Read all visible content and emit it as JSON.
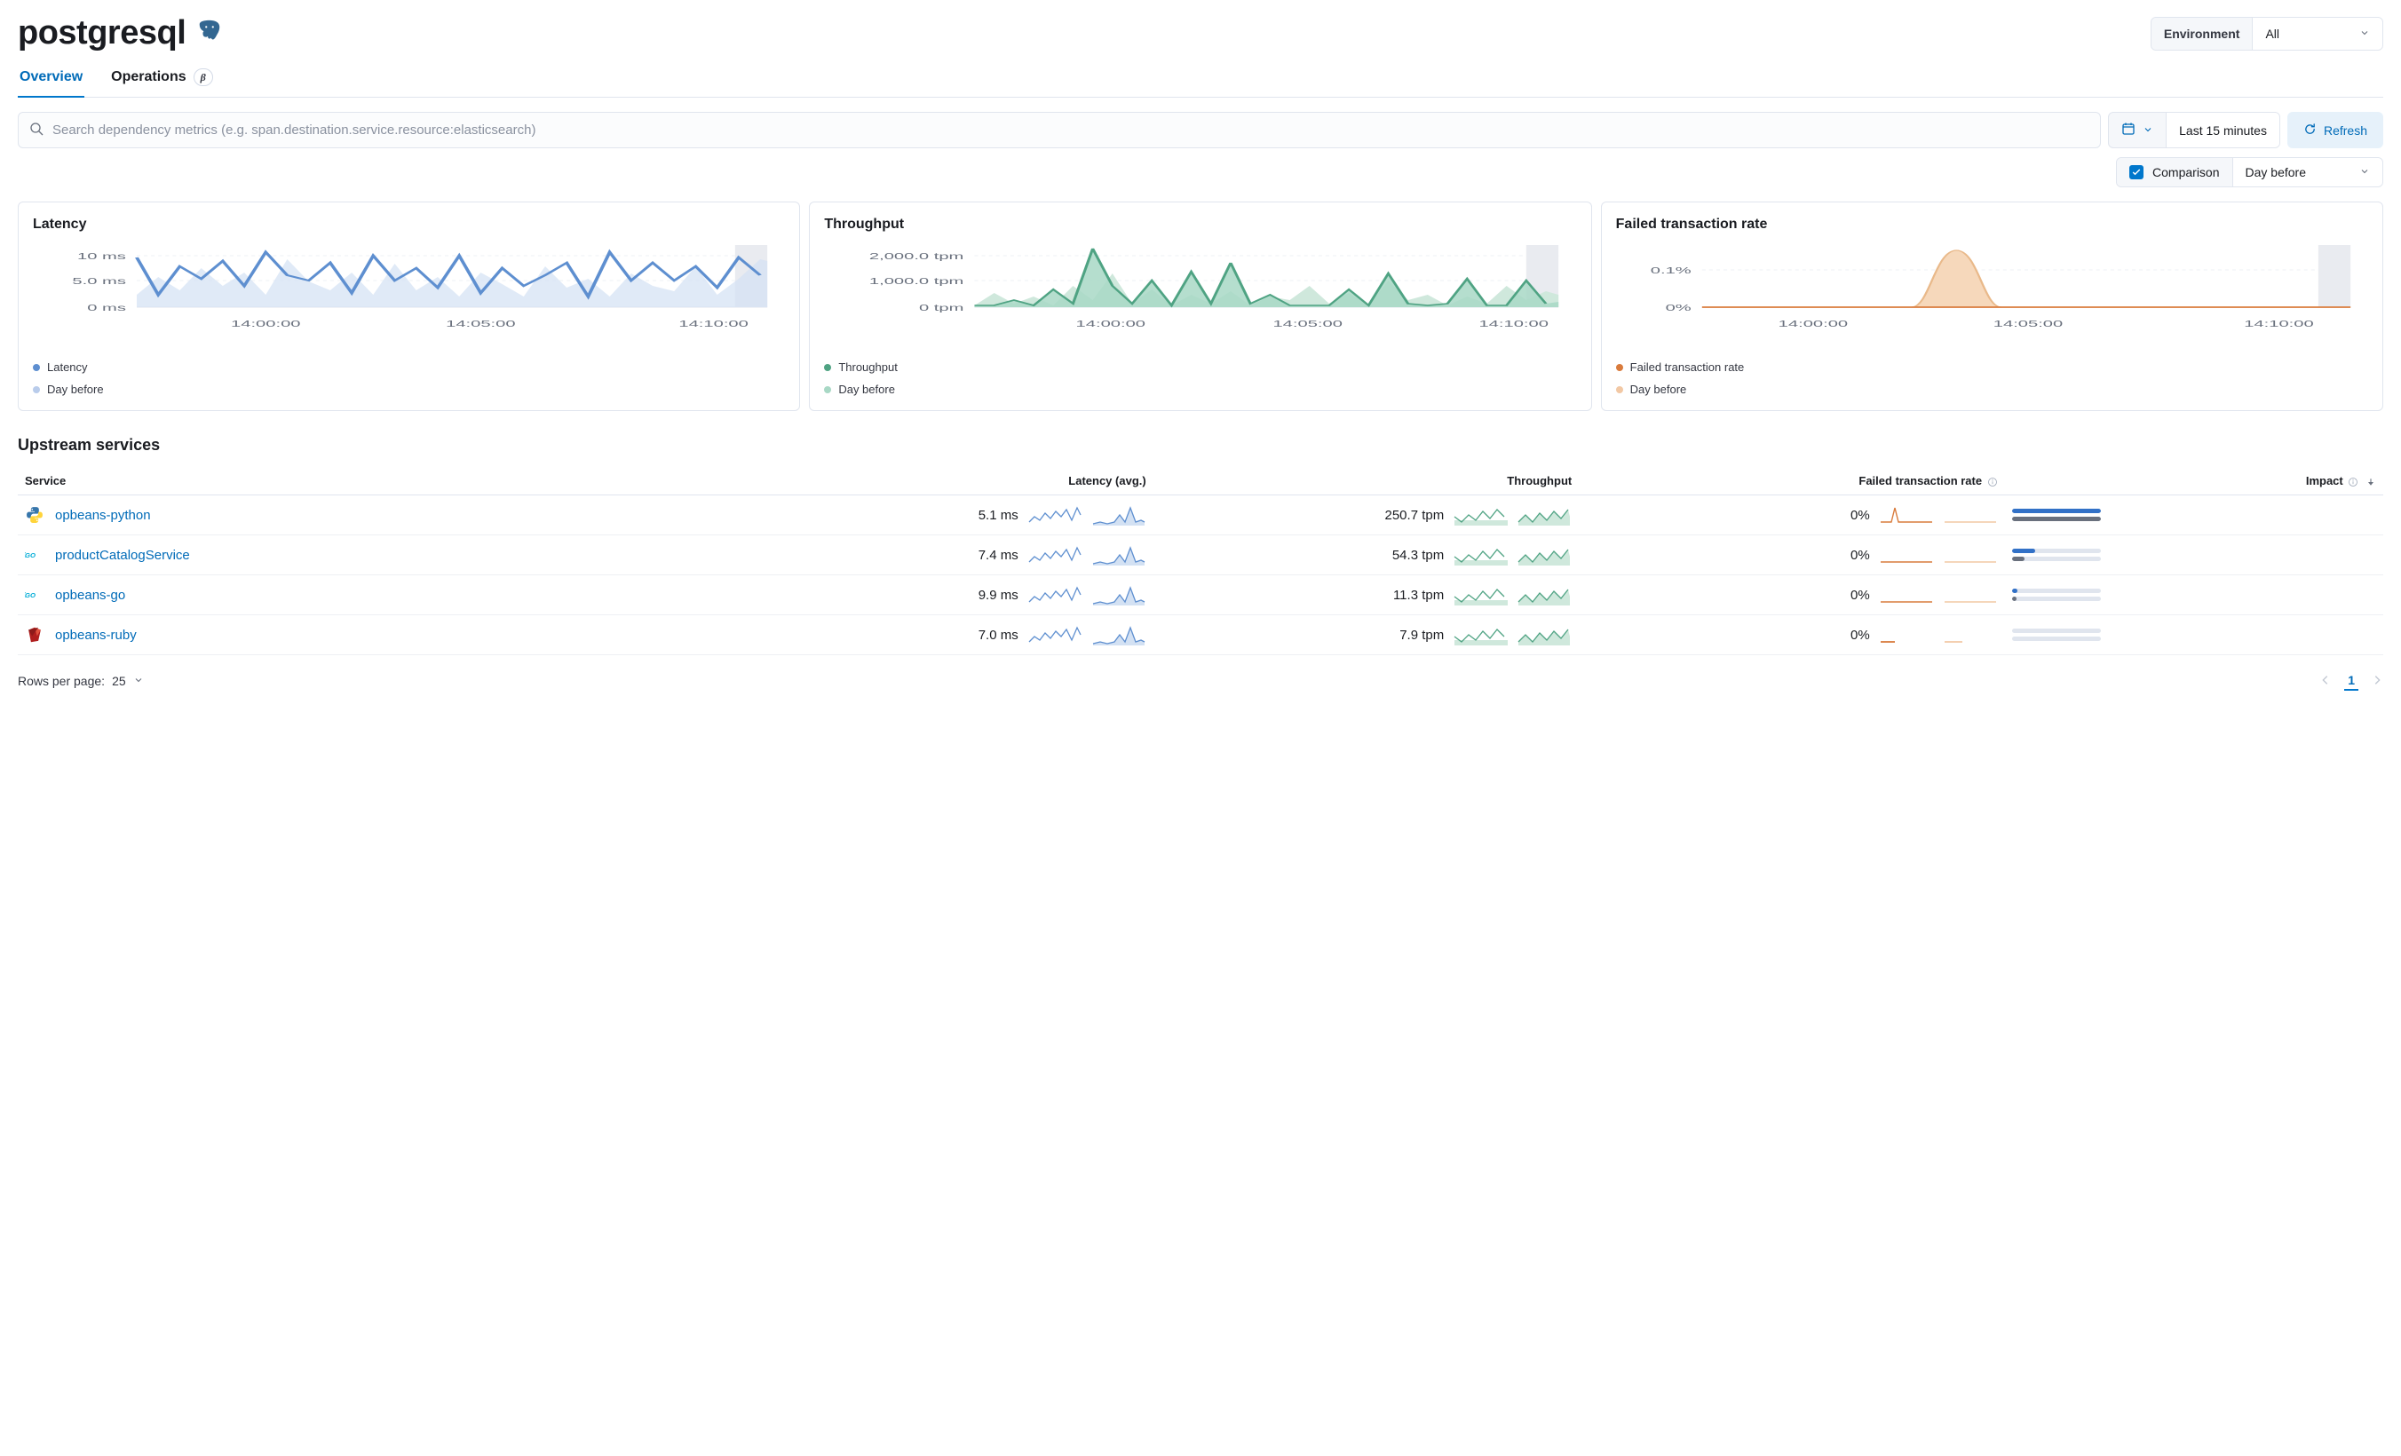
{
  "header": {
    "title": "postgresql",
    "environment_label": "Environment",
    "environment_value": "All"
  },
  "tabs": [
    {
      "label": "Overview",
      "active": true
    },
    {
      "label": "Operations",
      "active": false,
      "beta": "β"
    }
  ],
  "filters": {
    "search_placeholder": "Search dependency metrics (e.g. span.destination.service.resource:elasticsearch)",
    "time_range": "Last 15 minutes",
    "refresh_label": "Refresh",
    "comparison_label": "Comparison",
    "comparison_value": "Day before",
    "comparison_checked": true
  },
  "panels": {
    "latency": {
      "title": "Latency",
      "y_ticks": [
        "10 ms",
        "5.0 ms",
        "0 ms"
      ],
      "x_ticks": [
        "14:00:00",
        "14:05:00",
        "14:10:00"
      ],
      "legend_primary": "Latency",
      "legend_compare": "Day before",
      "color_primary": "#5e8fd0",
      "color_compare": "#b9cceb"
    },
    "throughput": {
      "title": "Throughput",
      "y_ticks": [
        "2,000.0 tpm",
        "1,000.0 tpm",
        "0 tpm"
      ],
      "x_ticks": [
        "14:00:00",
        "14:05:00",
        "14:10:00"
      ],
      "legend_primary": "Throughput",
      "legend_compare": "Day before",
      "color_primary": "#4fa383",
      "color_compare": "#a8d8c5"
    },
    "failed": {
      "title": "Failed transaction rate",
      "y_ticks": [
        "0.1%",
        "0%"
      ],
      "x_ticks": [
        "14:00:00",
        "14:05:00",
        "14:10:00"
      ],
      "legend_primary": "Failed transaction rate",
      "legend_compare": "Day before",
      "color_primary": "#d97b3c",
      "color_compare": "#f2c8a4"
    }
  },
  "chart_data": [
    {
      "type": "line",
      "title": "Latency",
      "xlabel": "",
      "ylabel": "",
      "x_ticks": [
        "14:00:00",
        "14:05:00",
        "14:10:00"
      ],
      "ylim": [
        0,
        12
      ],
      "y_unit": "ms",
      "series": [
        {
          "name": "Latency",
          "values": [
            10,
            3,
            8,
            6,
            9,
            5,
            11,
            7,
            6,
            9,
            4,
            10,
            6,
            8,
            5,
            10,
            4,
            8,
            5,
            7,
            9,
            3,
            11,
            6,
            9,
            6,
            8,
            5,
            10,
            7
          ]
        },
        {
          "name": "Day before",
          "values": [
            4,
            7,
            5,
            9,
            6,
            8,
            4,
            10,
            7,
            5,
            8,
            4,
            9,
            5,
            7,
            4,
            8,
            6,
            4,
            9,
            5,
            7,
            4,
            8,
            6,
            5,
            9,
            4,
            7,
            10
          ]
        }
      ]
    },
    {
      "type": "area",
      "title": "Throughput",
      "xlabel": "",
      "ylabel": "",
      "x_ticks": [
        "14:00:00",
        "14:05:00",
        "14:10:00"
      ],
      "ylim": [
        0,
        2400
      ],
      "y_unit": "tpm",
      "series": [
        {
          "name": "Throughput",
          "values": [
            100,
            100,
            300,
            100,
            800,
            200,
            2400,
            900,
            200,
            1100,
            100,
            1500,
            200,
            1800,
            200,
            600,
            100,
            100,
            100,
            800,
            100,
            1400,
            200,
            100,
            200,
            1200,
            100,
            100,
            1100,
            200
          ]
        },
        {
          "name": "Day before",
          "values": [
            100,
            600,
            200,
            400,
            100,
            900,
            300,
            1500,
            200,
            800,
            100,
            500,
            200,
            700,
            100,
            400,
            300,
            900,
            200,
            600,
            100,
            1100,
            300,
            500,
            100,
            400,
            200,
            900,
            300,
            700
          ]
        }
      ]
    },
    {
      "type": "area",
      "title": "Failed transaction rate",
      "xlabel": "",
      "ylabel": "",
      "x_ticks": [
        "14:00:00",
        "14:05:00",
        "14:10:00"
      ],
      "ylim": [
        0,
        0.12
      ],
      "y_unit": "%",
      "series": [
        {
          "name": "Failed transaction rate",
          "values": [
            0,
            0,
            0,
            0,
            0,
            0,
            0,
            0,
            0,
            0,
            0,
            0,
            0,
            0,
            0,
            0,
            0,
            0,
            0,
            0,
            0,
            0,
            0,
            0,
            0,
            0,
            0,
            0,
            0,
            0
          ]
        },
        {
          "name": "Day before",
          "values": [
            0,
            0,
            0,
            0,
            0,
            0,
            0,
            0,
            0,
            0,
            0,
            0,
            0.02,
            0.07,
            0.11,
            0.07,
            0.02,
            0,
            0,
            0,
            0,
            0,
            0,
            0,
            0,
            0,
            0,
            0,
            0,
            0
          ]
        }
      ]
    }
  ],
  "upstream": {
    "title": "Upstream services",
    "columns": {
      "service": "Service",
      "latency": "Latency (avg.)",
      "throughput": "Throughput",
      "failed": "Failed transaction rate",
      "impact": "Impact"
    },
    "rows": [
      {
        "service": "opbeans-python",
        "lang": "python",
        "latency": "5.1 ms",
        "throughput": "250.7 tpm",
        "failed": "0%",
        "impact_primary": 100,
        "impact_compare": 100
      },
      {
        "service": "productCatalogService",
        "lang": "go",
        "latency": "7.4 ms",
        "throughput": "54.3 tpm",
        "failed": "0%",
        "impact_primary": 26,
        "impact_compare": 14
      },
      {
        "service": "opbeans-go",
        "lang": "go",
        "latency": "9.9 ms",
        "throughput": "11.3 tpm",
        "failed": "0%",
        "impact_primary": 6,
        "impact_compare": 5
      },
      {
        "service": "opbeans-ruby",
        "lang": "ruby",
        "latency": "7.0 ms",
        "throughput": "7.9 tpm",
        "failed": "0%",
        "impact_primary": 0,
        "impact_compare": 0
      }
    ]
  },
  "pagination": {
    "rows_per_page_label": "Rows per page:",
    "rows_per_page_value": "25",
    "current_page": "1"
  }
}
